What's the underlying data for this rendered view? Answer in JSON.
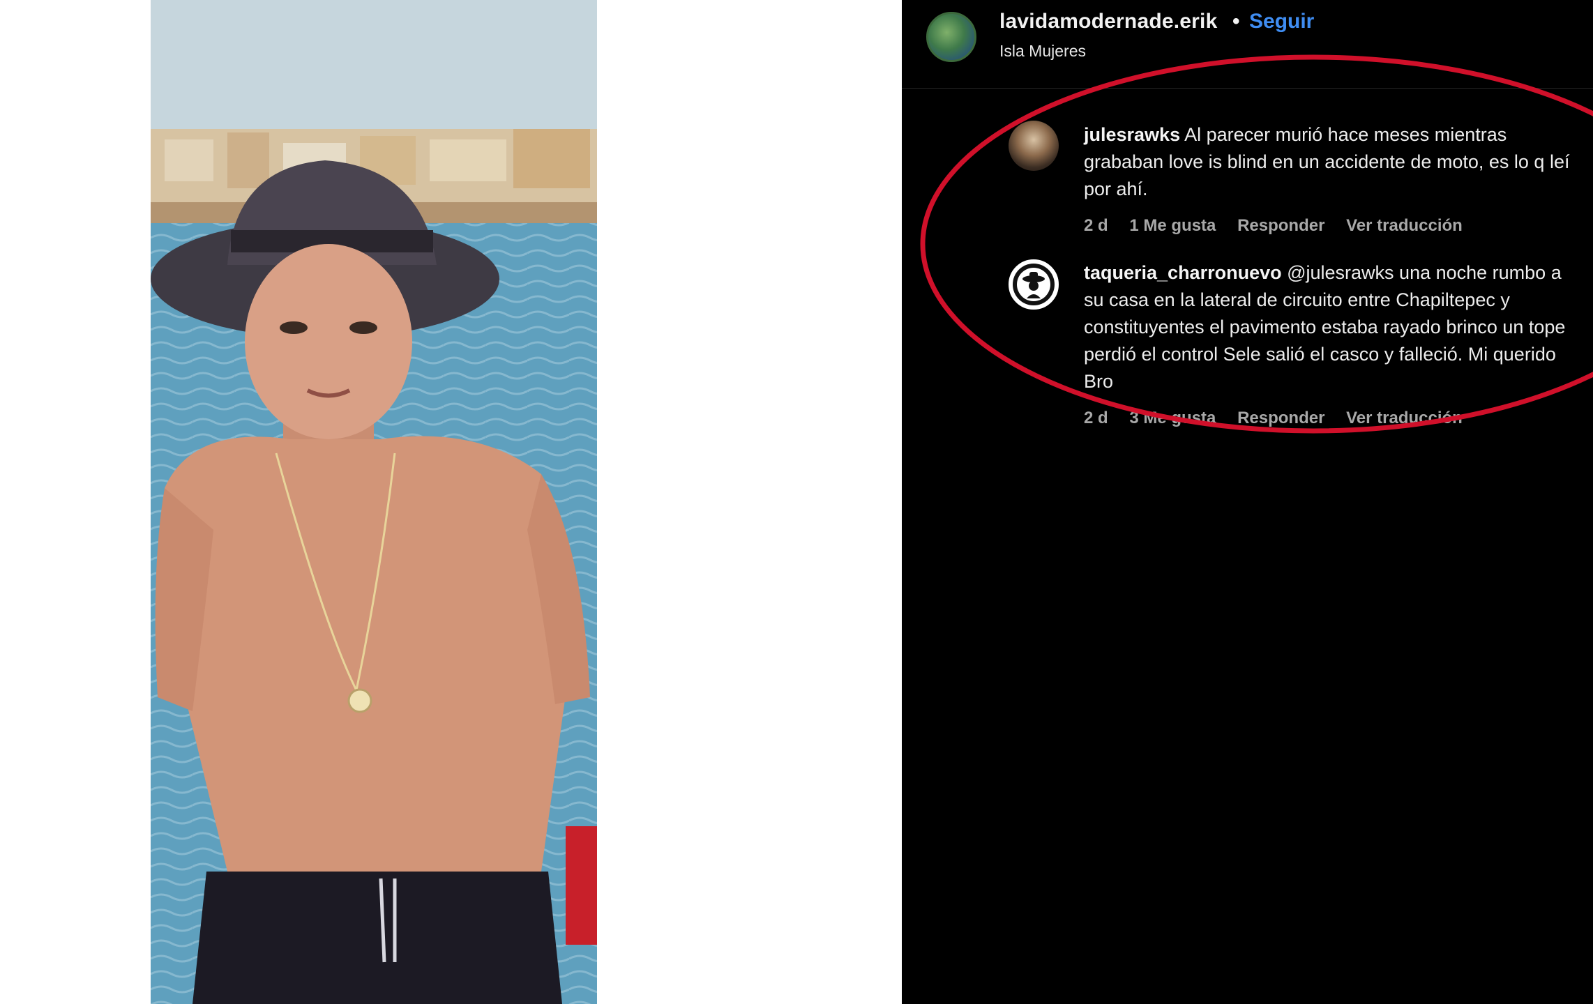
{
  "post": {
    "owner": "lavidamodernade.erik",
    "separator": "•",
    "follow_label": "Seguir",
    "location": "Isla Mujeres"
  },
  "comments": [
    {
      "username": "julesrawks",
      "text": "Al parecer murió hace meses mientras grababan love is blind en un accidente de moto, es lo q leí por ahí.",
      "time": "2 d",
      "likes": "1 Me gusta",
      "reply": "Responder",
      "translate": "Ver traducción"
    },
    {
      "username": "taqueria_charronuevo",
      "text": "@julesrawks una noche rumbo a su casa en la lateral de circuito entre Chapiltepec y constituyentes el pavimento estaba rayado brinco un tope perdió el control Sele salió el casco y falleció. Mi querido Bro",
      "time": "2 d",
      "likes": "3 Me gusta",
      "reply": "Responder",
      "translate": "Ver traducción"
    }
  ],
  "colors": {
    "follow": "#3f8df2",
    "annotation_circle": "#d0102a",
    "panel_bg": "#000000"
  }
}
